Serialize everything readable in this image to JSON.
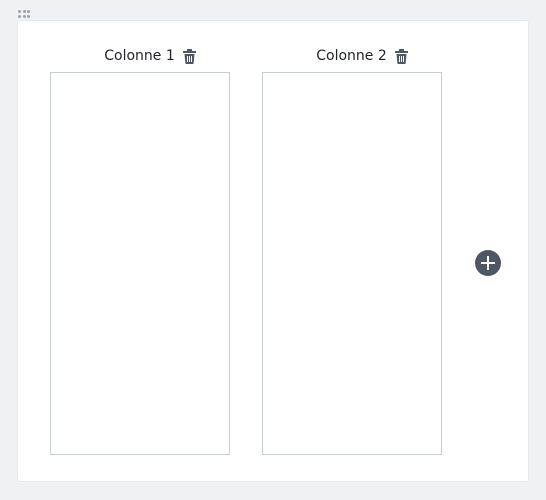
{
  "columns": [
    {
      "title": "Colonne 1",
      "delete_icon": "trash-icon"
    },
    {
      "title": "Colonne 2",
      "delete_icon": "trash-icon"
    }
  ],
  "add_button": {
    "icon": "plus-icon"
  },
  "drag_handle": {
    "icon": "grip-dots-icon"
  },
  "colors": {
    "page_background": "#eef2f5",
    "card_background": "#ffffff",
    "column_border": "#c6cdd3",
    "icon_dark": "#4d5661",
    "text": "#1f2329"
  }
}
